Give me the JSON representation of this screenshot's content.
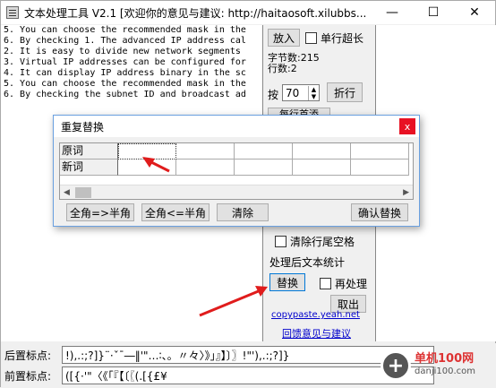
{
  "window": {
    "title": "文本处理工具 V2.1 [欢迎你的意见与建议:  http://haitaosoft.xilubbs...",
    "min_glyph": "—",
    "max_glyph": "☐",
    "close_glyph": "✕"
  },
  "editor": {
    "lines": [
      "5. You can choose the recommended mask in the",
      "6. By checking 1. The advanced IP address cal",
      "2. It is easy to divide new network segments",
      "3. Virtual IP addresses can be configured for",
      "4. It can display IP address binary in the sc",
      "5. You can choose the recommended mask in the",
      "6. By checking the subnet ID and broadcast ad"
    ]
  },
  "right_panel": {
    "put_in": "放入",
    "single_line_over": "单行超长",
    "byte_count": "字节数:215",
    "line_count": "行数:2",
    "by_label": "按",
    "wrap_value": "70",
    "fold_line": "折行",
    "partial_button": "每行首添",
    "clear_trailing_space": "清除行尾空格",
    "post_stats": "处理后文本统计",
    "replace": "替换",
    "reprocess": "再处理",
    "take_out": "取出",
    "link_site": "copypaste.yeah.net",
    "link_feedback": "回馈意见与建议"
  },
  "dialog": {
    "title": "重复替换",
    "row_original": "原词",
    "row_new": "新词",
    "btn_full_to_half": "全角=>半角",
    "btn_half_to_full": "全角<=半角",
    "btn_clear": "清除",
    "btn_confirm": "确认替换",
    "close_glyph": "x"
  },
  "bottom": {
    "after_label": "后置标点:",
    "after_value": "!),.:;?]}¨·ˇˉ―‖'\"…∶、。〃々〉》」』】〕〗!\"'),.:;?]}",
    "before_label": "前置标点:",
    "before_value": "([{·'\"〈《「『【〔〖(.[{£¥"
  },
  "watermark": {
    "text": "单机100网",
    "url": "danji100.com"
  },
  "colors": {
    "arrow": "#e01c1c",
    "link": "#0000cc",
    "close_red": "#e81123"
  }
}
